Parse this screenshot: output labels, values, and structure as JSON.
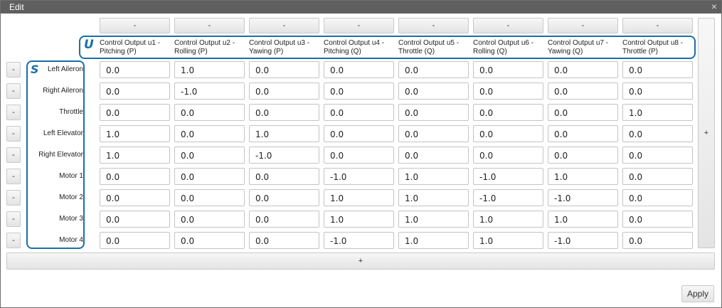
{
  "window": {
    "title": "Edit",
    "close_label": "×"
  },
  "column_remove_label": "-",
  "row_remove_label": "-",
  "add_column_label": "+",
  "add_row_label": "+",
  "apply_label": "Apply",
  "markers": {
    "outputs": "U",
    "surfaces": "S"
  },
  "columns": [
    {
      "line1": "Control Output u1 -",
      "line2": "Pitching (P)"
    },
    {
      "line1": "Control Output u2 -",
      "line2": "Rolling (P)"
    },
    {
      "line1": "Control Output u3 -",
      "line2": "Yawing (P)"
    },
    {
      "line1": "Control Output u4 -",
      "line2": "Pitching (Q)"
    },
    {
      "line1": "Control Output u5 -",
      "line2": "Throttle (Q)"
    },
    {
      "line1": "Control Output u6 -",
      "line2": "Rolling (Q)"
    },
    {
      "line1": "Control Output u7 -",
      "line2": "Yawing (Q)"
    },
    {
      "line1": "Control Output u8 -",
      "line2": "Throttle (P)"
    }
  ],
  "rows": [
    {
      "label": "Left Aileron",
      "values": [
        "0.0",
        "1.0",
        "0.0",
        "0.0",
        "0.0",
        "0.0",
        "0.0",
        "0.0"
      ]
    },
    {
      "label": "Right Aileron",
      "values": [
        "0.0",
        "-1.0",
        "0.0",
        "0.0",
        "0.0",
        "0.0",
        "0.0",
        "0.0"
      ]
    },
    {
      "label": "Throttle",
      "values": [
        "0.0",
        "0.0",
        "0.0",
        "0.0",
        "0.0",
        "0.0",
        "0.0",
        "1.0"
      ]
    },
    {
      "label": "Left Elevator",
      "values": [
        "1.0",
        "0.0",
        "1.0",
        "0.0",
        "0.0",
        "0.0",
        "0.0",
        "0.0"
      ]
    },
    {
      "label": "Right Elevator",
      "values": [
        "1.0",
        "0.0",
        "-1.0",
        "0.0",
        "0.0",
        "0.0",
        "0.0",
        "0.0"
      ]
    },
    {
      "label": "Motor 1",
      "values": [
        "0.0",
        "0.0",
        "0.0",
        "-1.0",
        "1.0",
        "-1.0",
        "1.0",
        "0.0"
      ]
    },
    {
      "label": "Motor 2",
      "values": [
        "0.0",
        "0.0",
        "0.0",
        "1.0",
        "1.0",
        "-1.0",
        "-1.0",
        "0.0"
      ]
    },
    {
      "label": "Motor 3",
      "values": [
        "0.0",
        "0.0",
        "0.0",
        "1.0",
        "1.0",
        "1.0",
        "1.0",
        "0.0"
      ]
    },
    {
      "label": "Motor 4",
      "values": [
        "0.0",
        "0.0",
        "0.0",
        "-1.0",
        "1.0",
        "1.0",
        "-1.0",
        "0.0"
      ]
    }
  ]
}
